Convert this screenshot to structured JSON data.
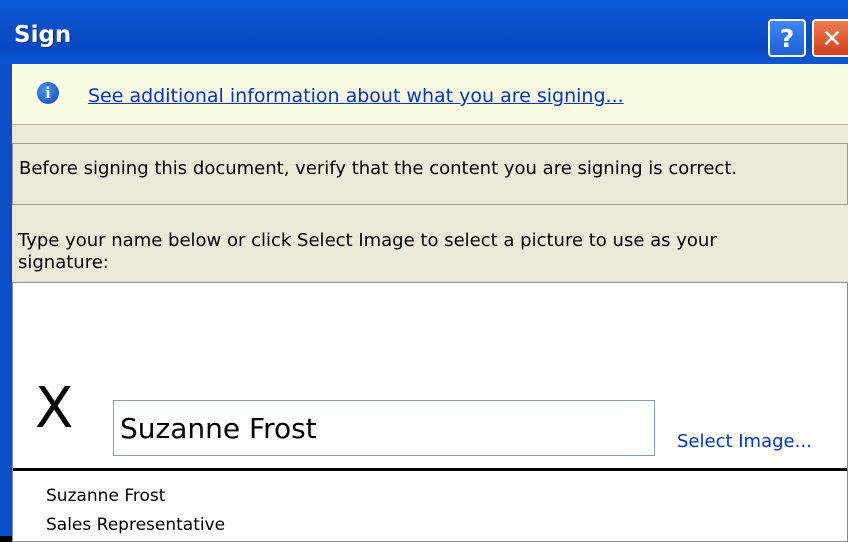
{
  "window": {
    "title": "Sign",
    "help_label": "?",
    "close_label": "✕"
  },
  "infobar": {
    "icon": "info-icon",
    "icon_glyph": "i",
    "link": "See additional information about what you are signing..."
  },
  "verify": {
    "text": "Before signing this document, verify that the content you are signing is correct."
  },
  "instructions": {
    "line1": "Type your name below or click Select Image to select a picture to use as your",
    "line2": "signature:"
  },
  "signature": {
    "x_mark": "X",
    "name_value": "Suzanne Frost",
    "select_image_label": "Select Image...",
    "signer_name": "Suzanne Frost",
    "signer_title": "Sales Representative"
  },
  "colors": {
    "titlebar": "#0a4fc8",
    "link": "#0033cc",
    "dialog_bg": "#ece9d8",
    "infobar_bg": "#fbfbe3"
  }
}
